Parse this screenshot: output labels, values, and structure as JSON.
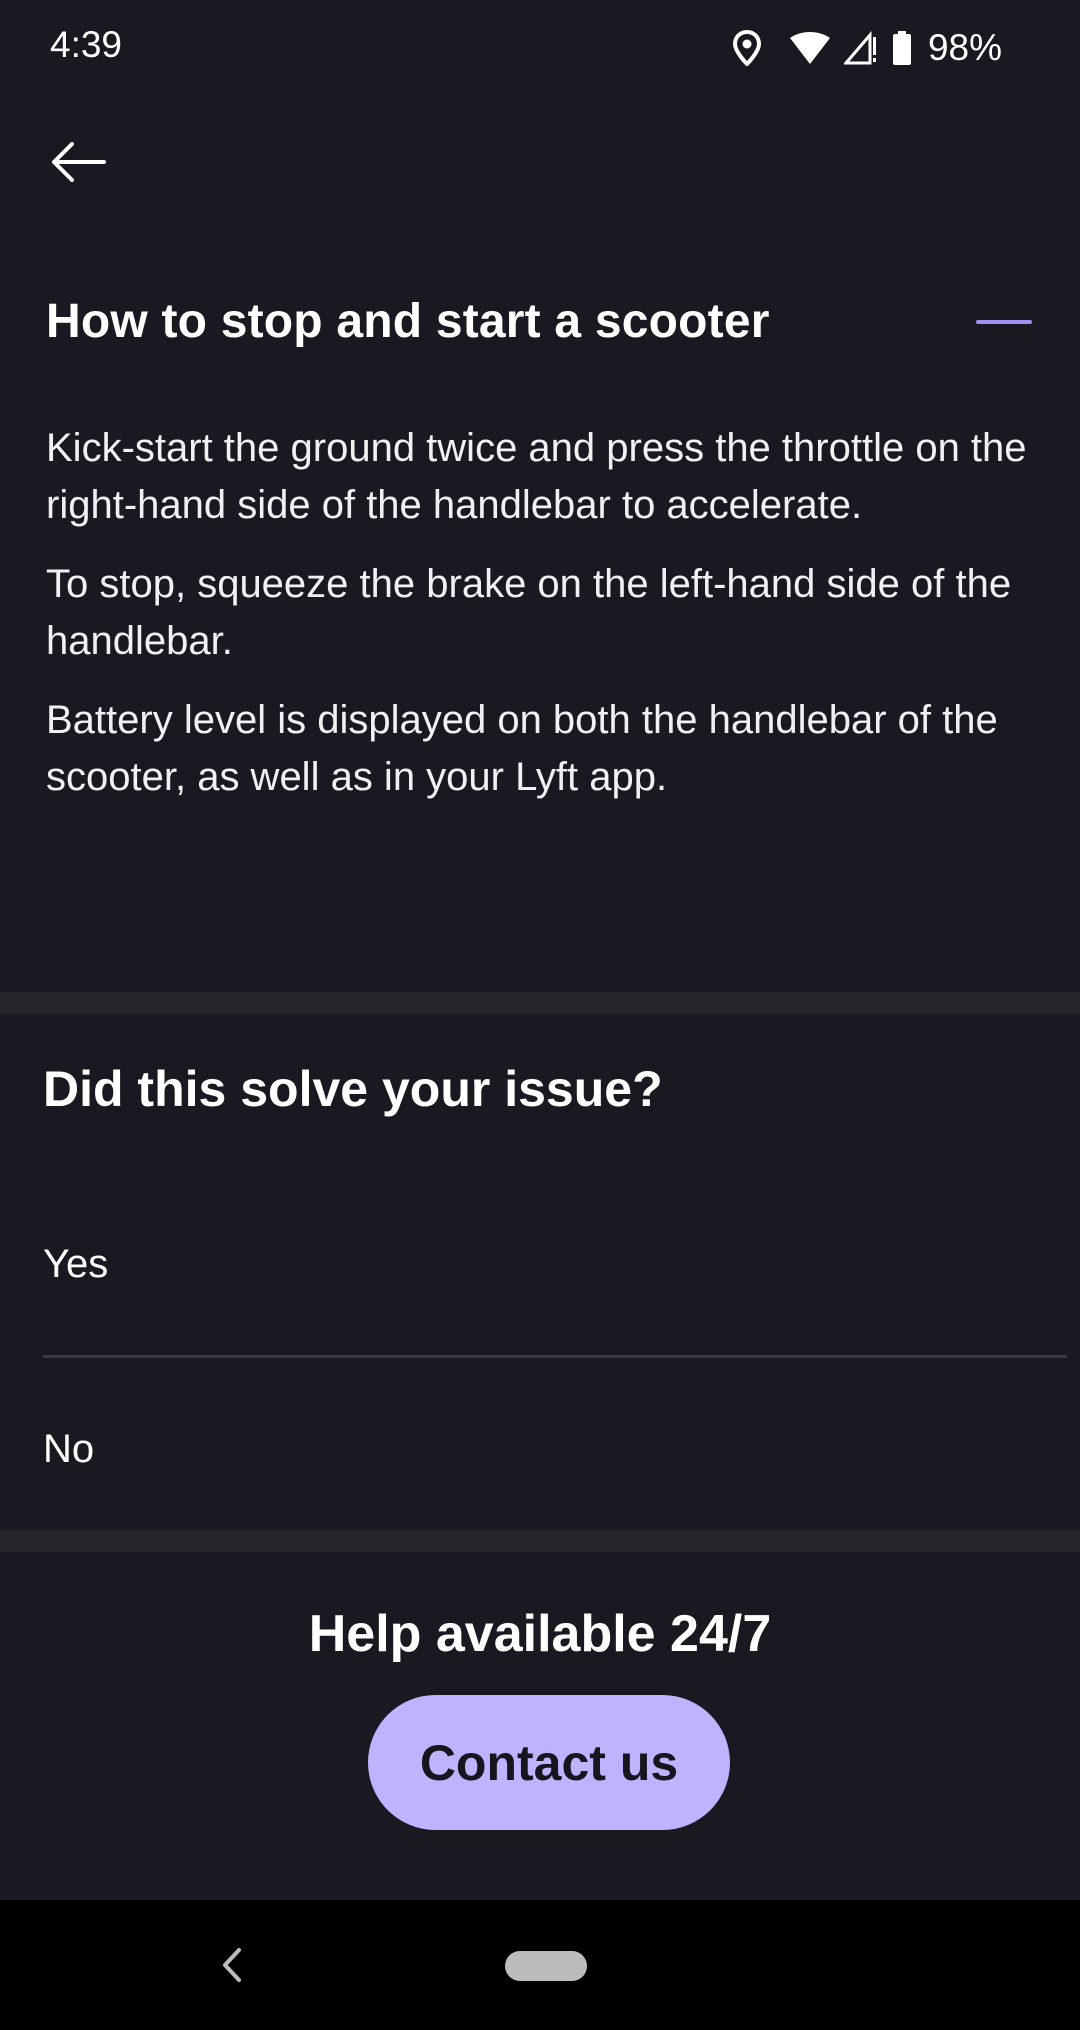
{
  "status_bar": {
    "time": "4:39",
    "battery_percent": "98%",
    "icons": [
      "location-icon",
      "wifi-icon",
      "signal-icon",
      "battery-icon"
    ]
  },
  "nav": {
    "back_icon": "arrow-left-icon"
  },
  "faq": {
    "title": "How to stop and start a scooter",
    "expanded": true,
    "paragraphs": [
      "Kick-start the ground twice and press the throttle on the right-hand side of the handlebar to accelerate.",
      "To stop, squeeze the brake on the left-hand side of the handlebar.",
      "Battery level is displayed on both the handlebar of the scooter, as well as in your Lyft app."
    ]
  },
  "feedback": {
    "question": "Did this solve your issue?",
    "options": [
      "Yes",
      "No"
    ]
  },
  "help": {
    "title": "Help available 24/7",
    "contact_label": "Contact us"
  },
  "colors": {
    "background": "#191a21",
    "divider": "#25262c",
    "accent": "#a58cf0",
    "button": "#bfb2ff"
  }
}
